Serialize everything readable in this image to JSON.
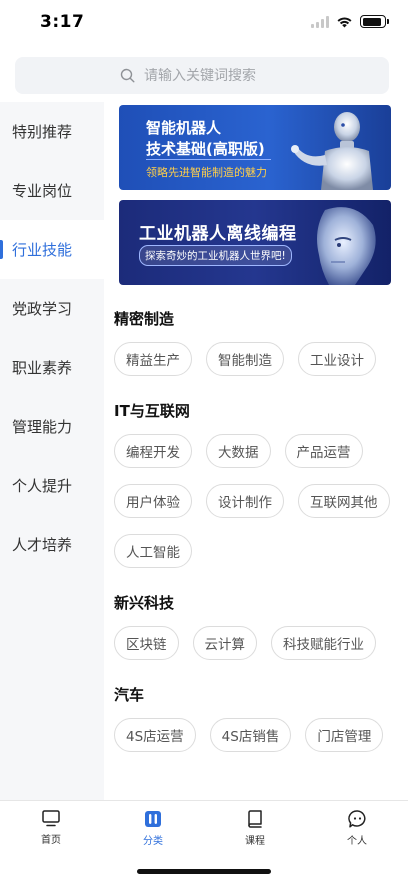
{
  "status_bar": {
    "time": "3:17",
    "battery_level": 0.9
  },
  "search": {
    "placeholder": "请输入关键词搜索"
  },
  "sidebar": {
    "items": [
      {
        "label": "特别推荐",
        "active": false
      },
      {
        "label": "专业岗位",
        "active": false
      },
      {
        "label": "行业技能",
        "active": true
      },
      {
        "label": "党政学习",
        "active": false
      },
      {
        "label": "职业素养",
        "active": false
      },
      {
        "label": "管理能力",
        "active": false
      },
      {
        "label": "个人提升",
        "active": false
      },
      {
        "label": "人才培养",
        "active": false
      }
    ]
  },
  "banners": [
    {
      "line1": "智能机器人",
      "line2": "技术基础(高职版)",
      "subtitle": "领略先进智能制造的魅力"
    },
    {
      "line1": "工业机器人离线编程",
      "subtitle": "探索奇妙的工业机器人世界吧!"
    }
  ],
  "sections": [
    {
      "title": "精密制造",
      "tags": [
        "精益生产",
        "智能制造",
        "工业设计"
      ]
    },
    {
      "title": "IT与互联网",
      "tags": [
        "编程开发",
        "大数据",
        "产品运营",
        "用户体验",
        "设计制作",
        "互联网其他",
        "人工智能"
      ]
    },
    {
      "title": "新兴科技",
      "tags": [
        "区块链",
        "云计算",
        "科技赋能行业"
      ]
    },
    {
      "title": "汽车",
      "tags": [
        "4S店运营",
        "4S店销售",
        "门店管理"
      ]
    }
  ],
  "tab_bar": {
    "tabs": [
      {
        "label": "首页",
        "icon": "monitor-icon",
        "active": false
      },
      {
        "label": "分类",
        "icon": "category-icon",
        "active": true
      },
      {
        "label": "课程",
        "icon": "book-icon",
        "active": false
      },
      {
        "label": "个人",
        "icon": "chat-bubble-icon",
        "active": false
      }
    ]
  },
  "colors": {
    "accent": "#2f6fdb",
    "banner_subtitle": "#ffcf4a"
  }
}
